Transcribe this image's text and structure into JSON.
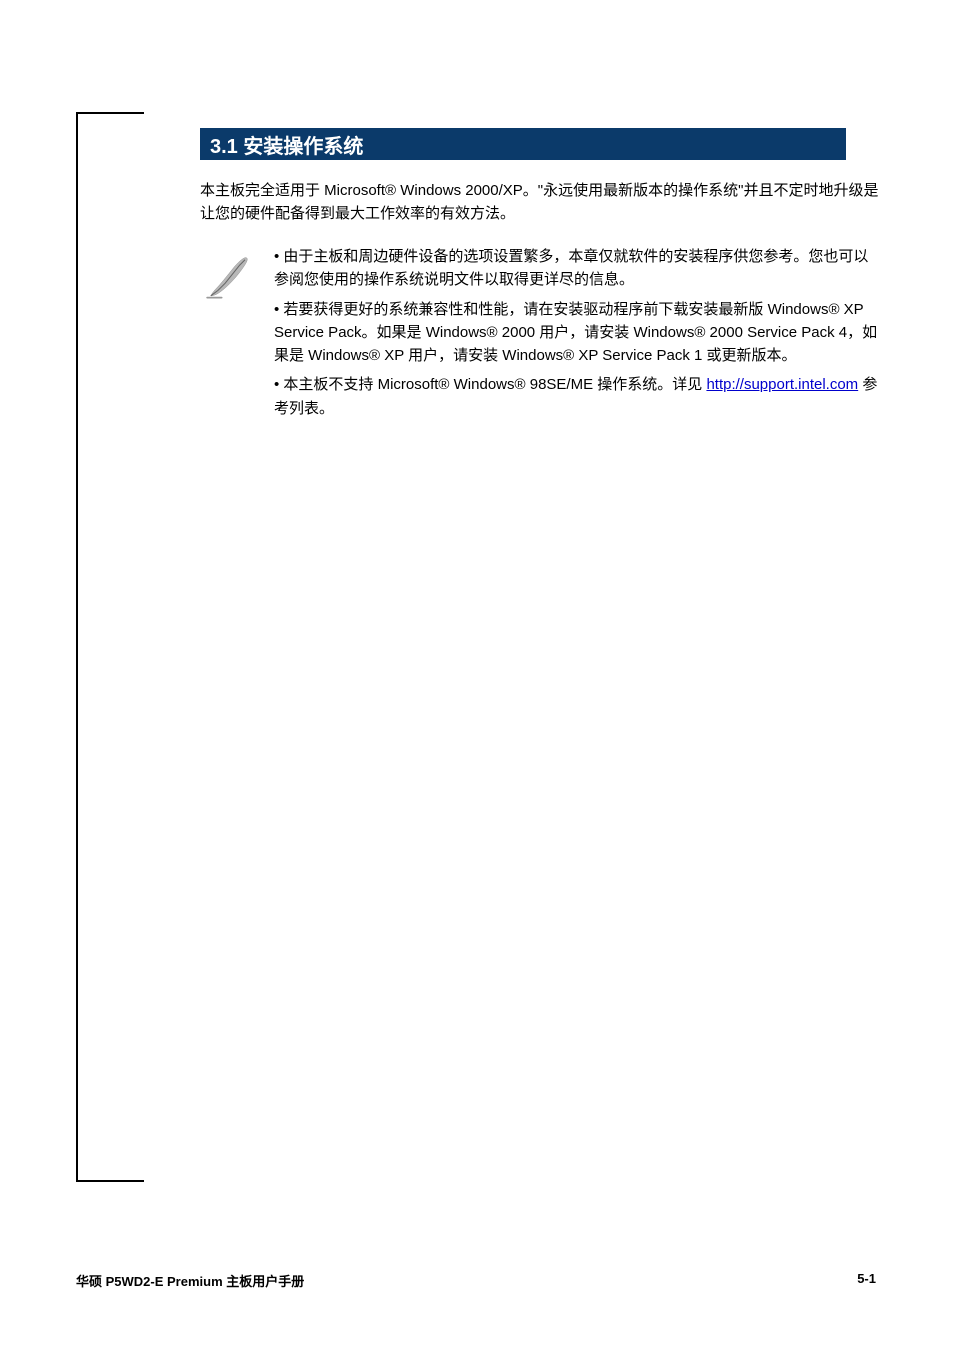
{
  "section": {
    "number": "3.1",
    "title_line1": "安装操作系统",
    "body_line1": "本主板完全适用于 Microsoft® Windows 2000/XP。\"永远使用最新版本的操作系统\"并且不定时地升级是让您的硬件配备得到最大工作效率的有效方法。",
    "banner": "3.1   安装操作系统",
    "body_line2": "本主板完全适用于 Microsoft® Windows 2000/XP。\"永远使用最新版本的操作系统\"并且不定时地升级是让您的硬件配备得到最大工作效率的有效方法。"
  },
  "note": {
    "bullet1_pre": "由于主板和周边硬件设备的选项设置繁多，本章仅就软件的安装程序供您参考。您也可以参阅您使用的操作系统说明文件以取得更详尽的信息。",
    "bullet2_pre": "若要获得更好的系统兼容性和性能，请在安装驱动程序前下载安装最新版 Windows® XP Service Pack。如果是 Windows® 2000 用户，请安装 Windows® 2000 Service Pack 4，如果是 Windows® XP 用户，请安装 Windows® XP Service Pack 1 或更新版本。",
    "bullet3_pre": "本主板不支持 Microsoft® Windows® 98SE/ME 操作系统。详见",
    "link": "http://support.intel.com",
    "bullet3_post": " 参考列表。"
  },
  "footer": {
    "title": "华硕 P5WD2-E Premium 主板用户手册",
    "page": "5-1"
  }
}
